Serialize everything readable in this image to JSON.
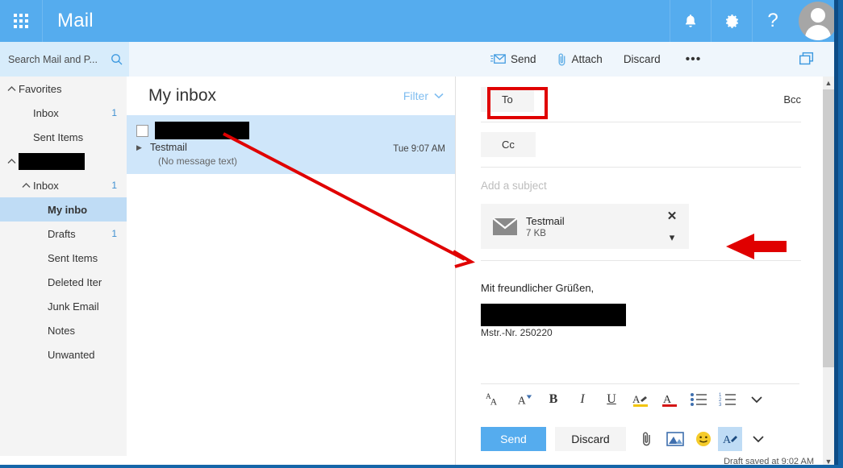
{
  "header": {
    "app_title": "Mail",
    "waffle_icon": "app-launcher-grid-icon",
    "bell_icon": "notifications-bell-icon",
    "gear_icon": "settings-gear-icon",
    "help_label": "?",
    "avatar_icon": "user-avatar-icon"
  },
  "search": {
    "placeholder": "Search Mail and P...",
    "icon": "search-magnifier-icon"
  },
  "compose_toolbar": {
    "send_label": "Send",
    "send_icon": "send-envelope-icon",
    "attach_label": "Attach",
    "attach_icon": "paperclip-icon",
    "discard_label": "Discard",
    "more_label": "•••",
    "popout_icon": "pop-out-window-icon"
  },
  "sidebar": {
    "items": [
      {
        "label": "Favorites",
        "count": "",
        "indent": 0,
        "chevron": "up",
        "selected": false,
        "redacted": false
      },
      {
        "label": "Inbox",
        "count": "1",
        "indent": 1,
        "chevron": "",
        "selected": false,
        "redacted": false
      },
      {
        "label": "Sent Items",
        "count": "",
        "indent": 1,
        "chevron": "",
        "selected": false,
        "redacted": false
      },
      {
        "label": "",
        "count": "",
        "indent": 0,
        "chevron": "up",
        "selected": false,
        "redacted": true
      },
      {
        "label": "Inbox",
        "count": "1",
        "indent": 1,
        "chevron": "up",
        "selected": false,
        "redacted": false
      },
      {
        "label": "My inbo",
        "count": "",
        "indent": 2,
        "chevron": "",
        "selected": true,
        "redacted": false
      },
      {
        "label": "Drafts",
        "count": "1",
        "indent": 2,
        "chevron": "",
        "selected": false,
        "redacted": false
      },
      {
        "label": "Sent Items",
        "count": "",
        "indent": 2,
        "chevron": "",
        "selected": false,
        "redacted": false
      },
      {
        "label": "Deleted Iter",
        "count": "",
        "indent": 2,
        "chevron": "",
        "selected": false,
        "redacted": false
      },
      {
        "label": "Junk Email",
        "count": "",
        "indent": 2,
        "chevron": "",
        "selected": false,
        "redacted": false
      },
      {
        "label": "Notes",
        "count": "",
        "indent": 2,
        "chevron": "",
        "selected": false,
        "redacted": false
      },
      {
        "label": "Unwanted",
        "count": "",
        "indent": 2,
        "chevron": "",
        "selected": false,
        "redacted": false
      }
    ]
  },
  "message_list": {
    "title": "My inbox",
    "filter_label": "Filter",
    "message": {
      "sender_redacted": true,
      "subject": "Testmail",
      "preview": "(No message text)",
      "time": "Tue 9:07 AM",
      "expand_icon": "expand-triangle-icon",
      "checkbox_icon": "message-checkbox"
    }
  },
  "compose": {
    "to_label": "To",
    "cc_label": "Cc",
    "bcc_label": "Bcc",
    "subject_placeholder": "Add a subject",
    "attachment": {
      "name": "Testmail",
      "size": "7 KB",
      "icon": "attachment-envelope-icon",
      "remove_icon": "remove-attachment-x-icon",
      "menu_icon": "attachment-chevron-down-icon"
    },
    "body_greeting": "Mit freundlicher Grüßen,",
    "body_signature_redacted": true,
    "body_cut_line": "Mstr.-Nr. 250220",
    "format_toolbar": [
      {
        "icon": "font-size-icon",
        "label": "AA"
      },
      {
        "icon": "font-color-dropdown-icon",
        "label": "A"
      },
      {
        "icon": "bold-icon",
        "label": "B"
      },
      {
        "icon": "italic-icon",
        "label": "I"
      },
      {
        "icon": "underline-icon",
        "label": "U"
      },
      {
        "icon": "highlight-icon",
        "label": "A"
      },
      {
        "icon": "text-color-icon",
        "label": "A"
      },
      {
        "icon": "bullet-list-icon",
        "label": ""
      },
      {
        "icon": "numbered-list-icon",
        "label": ""
      },
      {
        "icon": "more-formatting-chevron-icon",
        "label": ""
      }
    ],
    "send_button": "Send",
    "discard_button": "Discard",
    "bottom_icons": [
      {
        "icon": "attach-paperclip-icon"
      },
      {
        "icon": "insert-picture-icon"
      },
      {
        "icon": "emoji-icon"
      },
      {
        "icon": "formatting-pen-icon"
      },
      {
        "icon": "more-options-chevron-icon"
      }
    ],
    "draft_status": "Draft saved at 9:02 AM"
  },
  "scrollbar": {
    "up_icon": "scroll-up-arrow-icon",
    "down_icon": "scroll-down-arrow-icon"
  },
  "annotations": {
    "to_highlight": "red-rectangle-around-to-field",
    "arrow_to_compose": "red-arrow-from-message-list-to-compose",
    "arrow_to_attachment": "red-arrow-pointing-at-attachment",
    "color": "#e00000"
  },
  "colors": {
    "accent": "#55acee",
    "selection": "#cfe6fa",
    "sidebar_selection": "#bfdcf5",
    "annotation": "#e00000"
  }
}
